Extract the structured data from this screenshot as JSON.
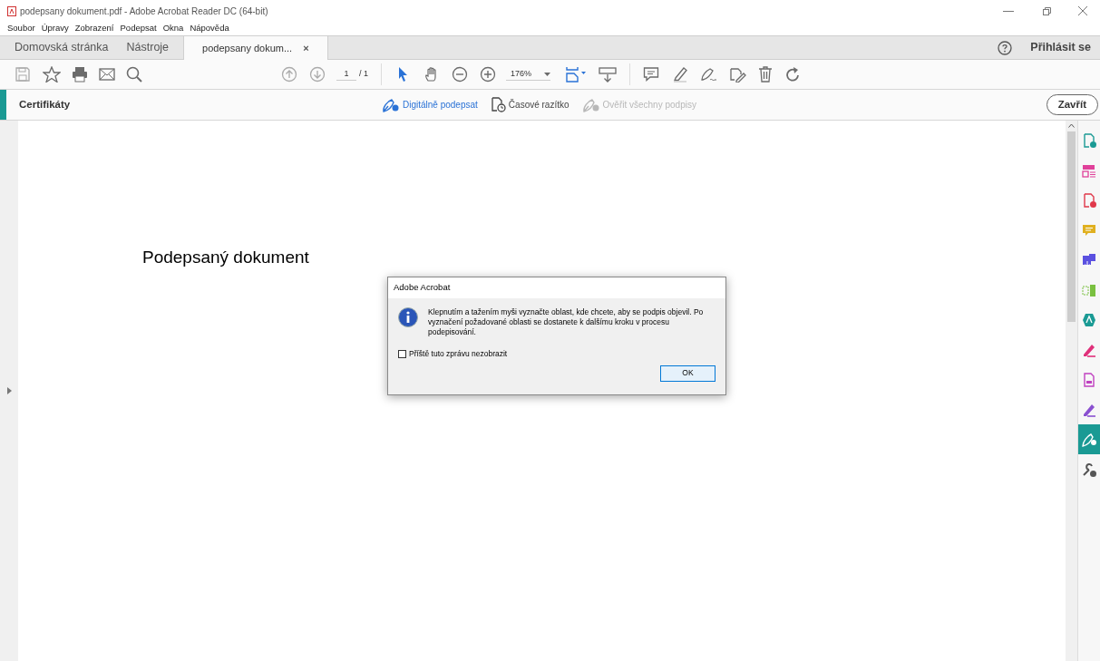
{
  "window": {
    "title": "podepsany dokument.pdf - Adobe Acrobat Reader DC (64-bit)"
  },
  "menu": [
    "Soubor",
    "Úpravy",
    "Zobrazení",
    "Podepsat",
    "Okna",
    "Nápověda"
  ],
  "tabs": [
    {
      "label": "Domovská stránka",
      "selected": false
    },
    {
      "label": "Nástroje",
      "selected": false
    },
    {
      "label": "podepsany dokum...",
      "selected": true,
      "close": "×"
    }
  ],
  "account": {
    "sign_in": "Přihlásit se"
  },
  "toolbar": {
    "page": "1",
    "page_count": "/ 1",
    "zoom": "176%"
  },
  "certificates_bar": {
    "title": "Certifikáty",
    "actions": [
      {
        "label": "Digitálně podepsat",
        "disabled": false,
        "kind": "sign"
      },
      {
        "label": "Časové razítko",
        "disabled": false,
        "kind": "stamp"
      },
      {
        "label": "Ověřit všechny podpisy",
        "disabled": true,
        "kind": "verify"
      }
    ],
    "close": "Zavřít"
  },
  "document": {
    "heading": "Podepsaný dokument"
  },
  "dialog": {
    "title": "Adobe Acrobat",
    "message": "Klepnutím a tažením myši vyznačte oblast, kde chcete, aby se podpis objevil. Po vyznačení požadované oblasti se dostanete k dalšímu kroku v procesu podepisování.",
    "checkbox": {
      "label": "Příště tuto zprávu nezobrazit",
      "checked": false
    },
    "ok": "OK"
  },
  "right_panel": [
    {
      "color": "#1a9a94",
      "selected": false
    },
    {
      "color": "#e0409a",
      "selected": false
    },
    {
      "color": "#e0384a",
      "selected": false
    },
    {
      "color": "#e0b020",
      "selected": false
    },
    {
      "color": "#5a50e0",
      "selected": false
    },
    {
      "color": "#7ac040",
      "selected": false
    },
    {
      "color": "#1a9a94",
      "selected": false
    },
    {
      "color": "#e0307a",
      "selected": false
    },
    {
      "color": "#c040c0",
      "selected": false
    },
    {
      "color": "#8a50d0",
      "selected": false
    },
    {
      "color": "#ffffff",
      "selected": true
    },
    {
      "color": "#555555",
      "selected": false
    }
  ]
}
